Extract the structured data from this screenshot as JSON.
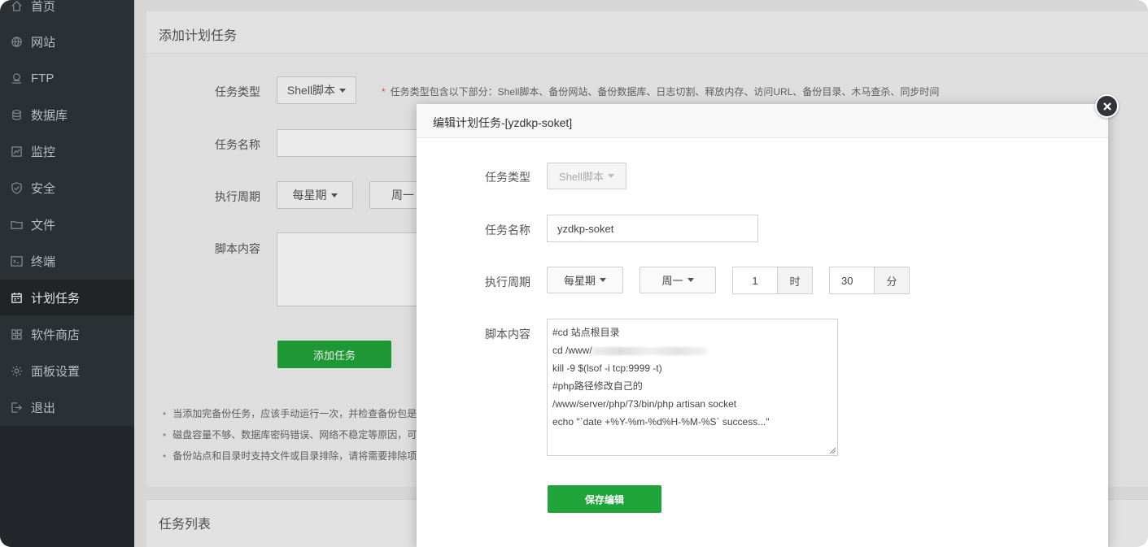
{
  "sidebar": {
    "items": [
      {
        "label": "首页",
        "icon": "home-icon"
      },
      {
        "label": "网站",
        "icon": "globe-icon"
      },
      {
        "label": "FTP",
        "icon": "ftp-icon"
      },
      {
        "label": "数据库",
        "icon": "database-icon"
      },
      {
        "label": "监控",
        "icon": "monitor-icon"
      },
      {
        "label": "安全",
        "icon": "shield-icon"
      },
      {
        "label": "文件",
        "icon": "folder-icon"
      },
      {
        "label": "终端",
        "icon": "terminal-icon"
      },
      {
        "label": "计划任务",
        "icon": "calendar-icon"
      },
      {
        "label": "软件商店",
        "icon": "grid-icon"
      },
      {
        "label": "面板设置",
        "icon": "gear-icon"
      },
      {
        "label": "退出",
        "icon": "logout-icon"
      }
    ],
    "active_index": 8
  },
  "add_panel": {
    "title": "添加计划任务",
    "task_type_label": "任务类型",
    "task_type_value": "Shell脚本",
    "task_type_hint": "任务类型包含以下部分：Shell脚本、备份网站、备份数据库、日志切割、释放内存、访问URL、备份目录、木马查杀、同步时间",
    "task_name_label": "任务名称",
    "cycle_label": "执行周期",
    "cycle_value": "每星期",
    "weekday_value": "周一",
    "script_label": "脚本内容",
    "add_button": "添加任务",
    "notes": [
      "当添加完备份任务，应该手动运行一次，并检查备份包是",
      "磁盘容量不够、数据库密码错误、网络不稳定等原因，可",
      "备份站点和目录时支持文件或目录排除，请将需要排除项"
    ]
  },
  "list_panel": {
    "title": "任务列表"
  },
  "modal": {
    "title": "编辑计划任务-[yzdkp-soket]",
    "task_type_label": "任务类型",
    "task_type_value": "Shell脚本",
    "task_name_label": "任务名称",
    "task_name_value": "yzdkp-soket",
    "cycle_label": "执行周期",
    "cycle_value": "每星期",
    "weekday_value": "周一",
    "hour_value": "1",
    "hour_unit": "时",
    "minute_value": "30",
    "minute_unit": "分",
    "script_label": "脚本内容",
    "script_lines": [
      "#cd 站点根目录",
      "cd  /www/",
      "kill -9 $(lsof -i tcp:9999 -t)",
      "#php路径修改自己的",
      "/www/server/php/73/bin/php artisan socket",
      "echo \"`date +%Y-%m-%d%H-%M-%S` success...\""
    ],
    "save_button": "保存编辑"
  },
  "colors": {
    "sidebar_bg": "#2f353a",
    "accent_green": "#20a53a",
    "hint_star": "#e74c3c"
  }
}
